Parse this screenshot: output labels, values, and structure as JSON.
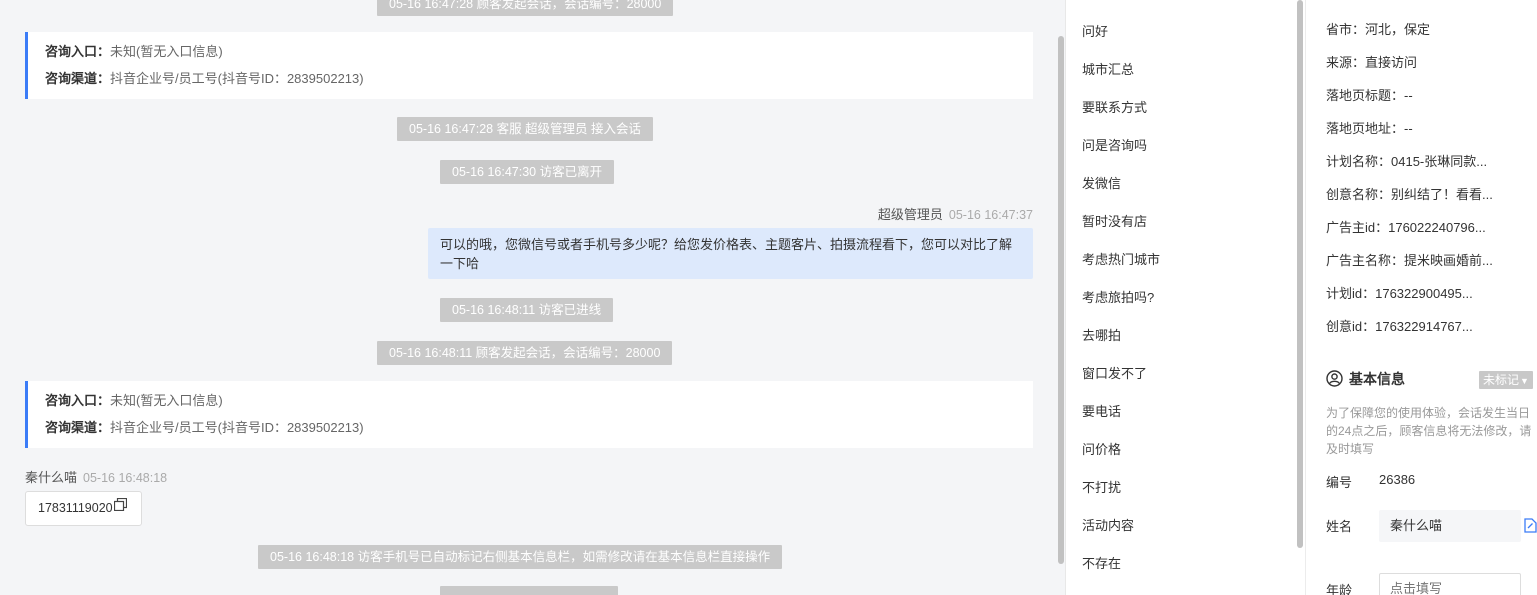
{
  "chat": {
    "sys_top": "05-16 16:47:28 顾客发起会话，会话编号：28000",
    "card1": {
      "entry_label": "咨询入口：",
      "entry_value": "未知(暂无入口信息)",
      "channel_label": "咨询渠道：",
      "channel_value": "抖音企业号/员工号(抖音号ID：2839502213)"
    },
    "sys_join": "05-16 16:47:28 客服 超级管理员 接入会话",
    "sys_leave": "05-16 16:47:30 访客已离开",
    "agent_name": "超级管理员",
    "agent_time": "05-16 16:47:37",
    "agent_message": "可以的哦，您微信号或者手机号多少呢？给您发价格表、主题客片、拍摄流程看下，您可以对比了解一下哈",
    "sys_online": "05-16 16:48:11 访客已进线",
    "sys_start": "05-16 16:48:11 顾客发起会话，会话编号：28000",
    "card2": {
      "entry_label": "咨询入口：",
      "entry_value": "未知(暂无入口信息)",
      "channel_label": "咨询渠道：",
      "channel_value": "抖音企业号/员工号(抖音号ID：2839502213)"
    },
    "visitor_name": "秦什么喵",
    "visitor_time": "05-16 16:48:18",
    "visitor_message": "17831119020",
    "sys_phone": "05-16 16:48:18 访客手机号已自动标记右侧基本信息栏，如需修改请在基本信息栏直接操作"
  },
  "quick_replies": [
    "问好",
    "城市汇总",
    "要联系方式",
    "问是咨询吗",
    "发微信",
    "暂时没有店",
    "考虑热门城市",
    "考虑旅拍吗?",
    "去哪拍",
    "窗口发不了",
    "要电话",
    "问价格",
    "不打扰",
    "活动内容",
    "不存在"
  ],
  "visitor_info": {
    "province": "省市：河北，保定",
    "source": "来源：直接访问",
    "landing_title": "落地页标题：--",
    "landing_url": "落地页地址：--",
    "plan_name": "计划名称：0415-张琳同款...",
    "creative_name": "创意名称：别纠结了！看看...",
    "advertiser_id": "广告主id：176022240796...",
    "advertiser_name": "广告主名称：提米映画婚前...",
    "plan_id": "计划id：176322900495...",
    "creative_id": "创意id：176322914767..."
  },
  "basic_info": {
    "title": "基本信息",
    "mark_label": "未标记",
    "note": "为了保障您的使用体验，会话发生当日的24点之后，顾客信息将无法修改，请及时填写",
    "number_label": "编号",
    "number_value": "26386",
    "name_label": "姓名",
    "name_value": "秦什么喵",
    "age_label": "年龄",
    "age_placeholder": "点击填写"
  },
  "colors": {
    "accent": "#3b7cf7",
    "outgoing_bubble": "#dde9fc",
    "system_pill": "#c9c9c9"
  }
}
